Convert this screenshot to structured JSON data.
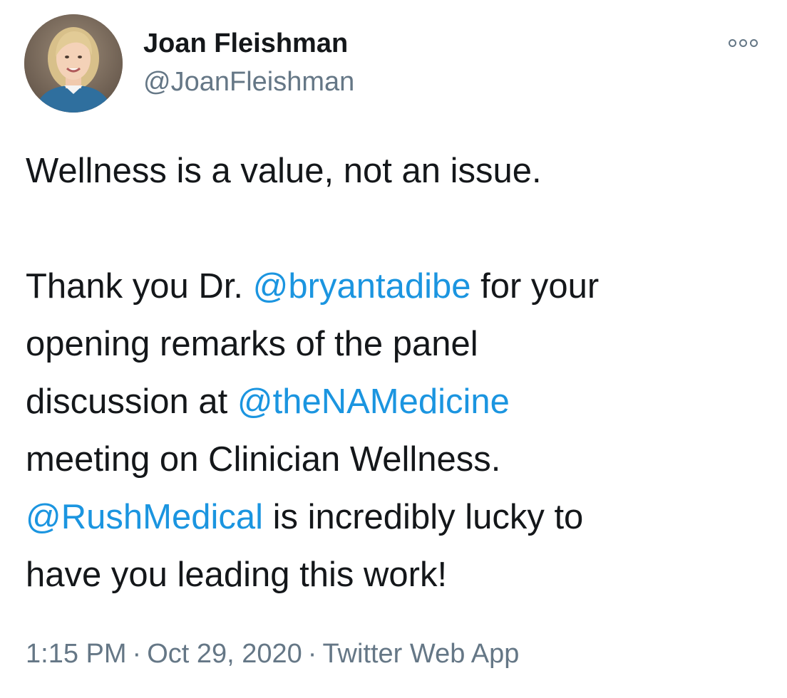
{
  "author": {
    "display_name": "Joan Fleishman",
    "handle": "@JoanFleishman"
  },
  "icons": {
    "avatar": "profile-photo",
    "more": "more-options-icon"
  },
  "tweet": {
    "line1": "Wellness is a value, not an issue.",
    "p2_a": "Thank you Dr. ",
    "p2_mention1": "@bryantadibe",
    "p2_b": " for your",
    "p3": "opening remarks of the panel",
    "p4_a": "discussion at ",
    "p4_mention2": "@theNAMedicine",
    "p5": "meeting on Clinician Wellness.",
    "p6_mention3": "@RushMedical",
    "p6_b": " is incredibly lucky to",
    "p7": "have you leading this work!"
  },
  "meta": {
    "time": "1:15 PM",
    "separator": "·",
    "date": "Oct 29, 2020",
    "source": "Twitter Web App"
  },
  "colors": {
    "link": "#1b95e0",
    "secondary": "#657786",
    "text": "#14171a"
  }
}
